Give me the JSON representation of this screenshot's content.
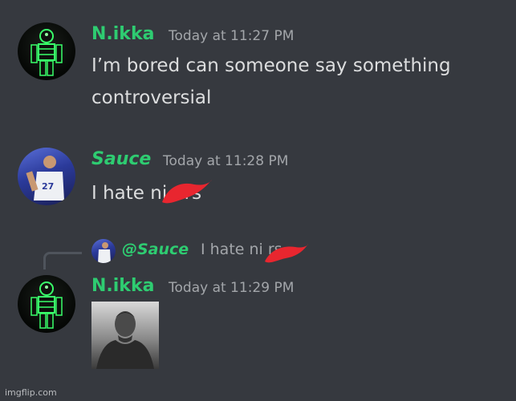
{
  "messages": [
    {
      "author": "N.ikka",
      "time": "Today at 11:27 PM",
      "text_line1": "I’m bored can someone say something",
      "text_line2": "controversial"
    },
    {
      "author": "Sauce",
      "time": "Today at 11:28 PM",
      "text": "I hate ni  ers"
    },
    {
      "reply": {
        "mention": "@Sauce",
        "text": "I hate ni     rs"
      },
      "author": "N.ikka",
      "time": "Today at 11:29 PM",
      "attachment": "image"
    }
  ],
  "watermark": "imgflip.com",
  "colors": {
    "background": "#36393f",
    "username": "#2ecc71",
    "timestamp": "#a3a6aa",
    "message_text": "#dcddde",
    "censor": "#e8262f"
  }
}
